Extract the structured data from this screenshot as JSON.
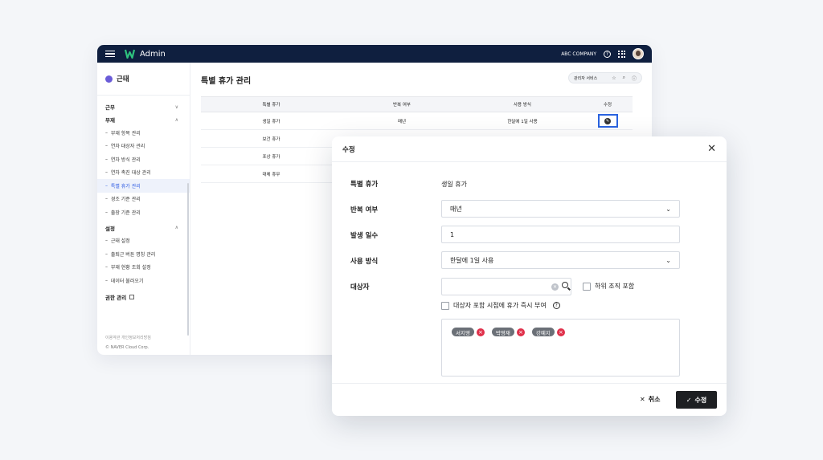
{
  "topbar": {
    "brand": "Admin",
    "company": "ABC COMPANY",
    "help_icon": "question-icon",
    "apps_icon": "grid-icon",
    "logo_color": "#2ec27e",
    "bg_color": "#0f1f3f"
  },
  "sidebar": {
    "title": "근태",
    "groups": [
      {
        "label": "근무",
        "chev": "∨"
      },
      {
        "label": "부재",
        "chev": "∧",
        "items": [
          "부재 항목 관리",
          "연차 대상자 관리",
          "연차 방식 관리",
          "연차 촉진 대상 관리",
          "특별 휴가 관리",
          "경조 기준 관리",
          "출장 기준 관리"
        ]
      },
      {
        "label": "설정",
        "chev": "∧",
        "items": [
          "근태 설정",
          "출퇴근 버튼 명칭 관리",
          "부재 현황 조회 설정",
          "데이터 불러오기"
        ]
      }
    ],
    "link": "권한 관리",
    "footer_links": "이용약관 개인정보처리방침",
    "copyright": "© NAVER Cloud Corp."
  },
  "main": {
    "title": "특별 휴가 관리",
    "admin_service": "관리자 서비스",
    "table": {
      "headers": [
        "특별 휴가",
        "반복 여부",
        "사용 방식",
        "수정"
      ],
      "rows": [
        [
          "생일 휴가",
          "매년",
          "한달에 1일 사용"
        ],
        [
          "보건 휴가",
          "",
          ""
        ],
        [
          "포상 휴가",
          "",
          ""
        ],
        [
          "대체 휴무",
          "",
          ""
        ]
      ]
    }
  },
  "modal": {
    "title": "수정",
    "close": "✕",
    "labels": {
      "special_leave": "특별 휴가",
      "repeat": "반복 여부",
      "days": "발생 일수",
      "usage": "사용 방식",
      "target": "대상자"
    },
    "values": {
      "special_leave": "생일 휴가",
      "repeat": "매년",
      "days": "1",
      "usage": "한달에 1일 사용",
      "search": ""
    },
    "checks": {
      "include_sub": "하위 조직 포함",
      "grant_now": "대상자 포함 시점에 휴가 즉시 부여"
    },
    "tags": [
      "서지영",
      "박영재",
      "강예지"
    ],
    "cancel": "취소",
    "save": "수정",
    "accent": "#e0304a"
  }
}
